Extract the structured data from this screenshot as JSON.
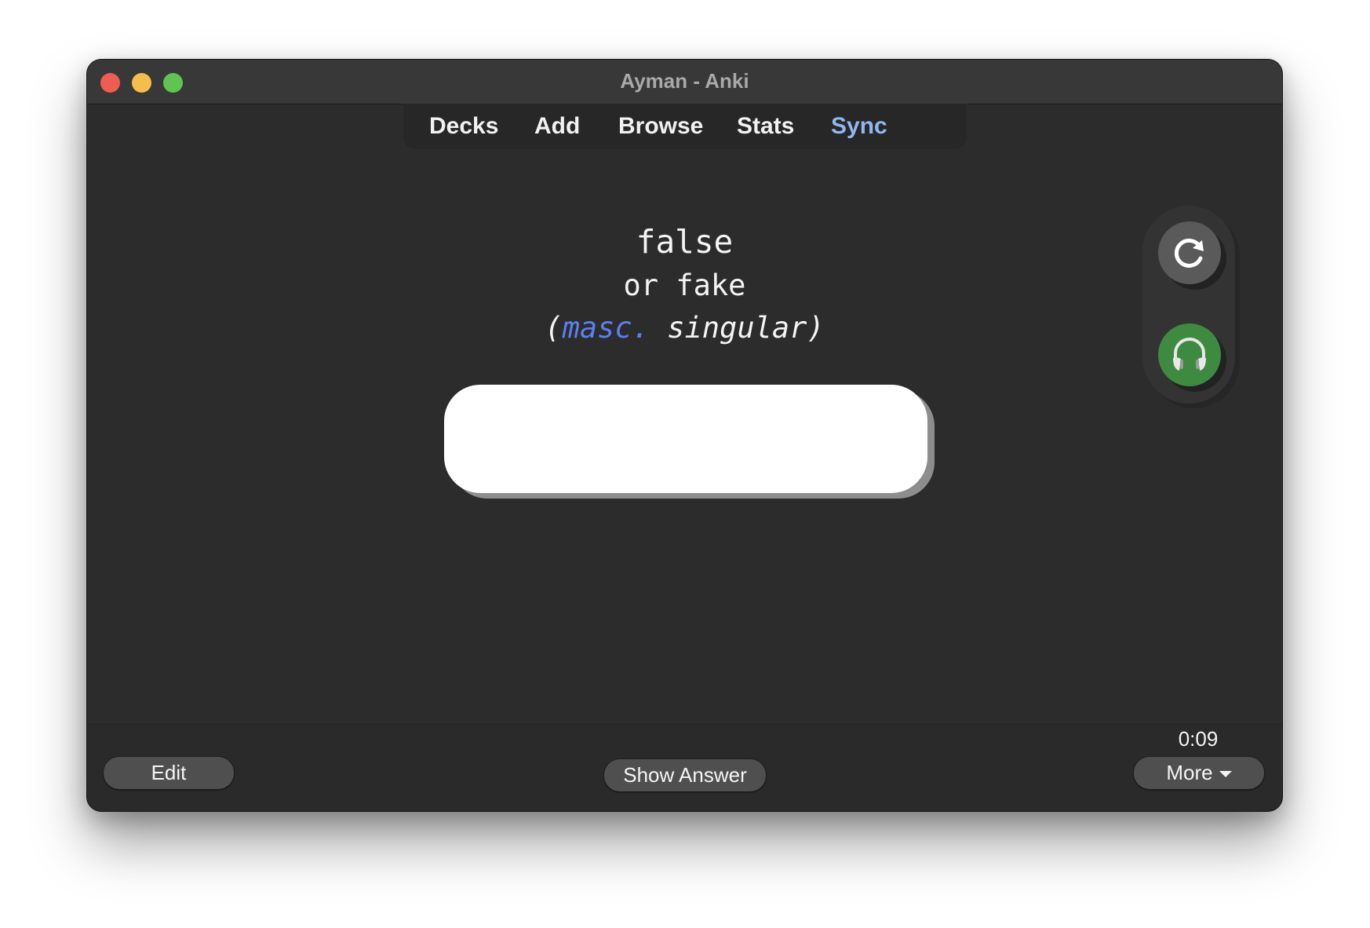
{
  "window": {
    "title": "Ayman - Anki"
  },
  "toolbar": {
    "items": [
      {
        "label": "Decks"
      },
      {
        "label": "Add"
      },
      {
        "label": "Browse"
      },
      {
        "label": "Stats"
      },
      {
        "label": "Sync"
      }
    ],
    "sync_color": "#8fb8f0"
  },
  "card": {
    "line1": "false",
    "line2": "or fake",
    "line3_open": "(",
    "line3_masc": "masc.",
    "line3_rest": " singular)",
    "masc_color": "#5b7ff0",
    "answer_input_value": ""
  },
  "side_controls": {
    "replay_icon": "replay-icon",
    "audio_icon": "headphones-icon",
    "audio_color": "#3e8a41"
  },
  "bottom": {
    "edit_label": "Edit",
    "show_answer_label": "Show Answer",
    "more_label": "More",
    "timer": "0:09"
  }
}
